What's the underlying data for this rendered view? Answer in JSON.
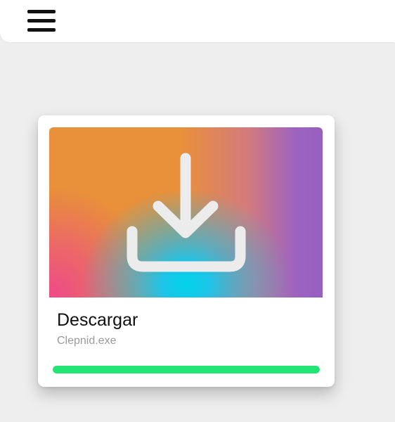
{
  "topbar": {
    "menu_icon": "hamburger-menu-icon"
  },
  "download_card": {
    "hero_icon": "download-icon",
    "title": "Descargar",
    "filename": "Clepnid.exe",
    "progress": 1.0,
    "progress_color": "#22e574"
  }
}
